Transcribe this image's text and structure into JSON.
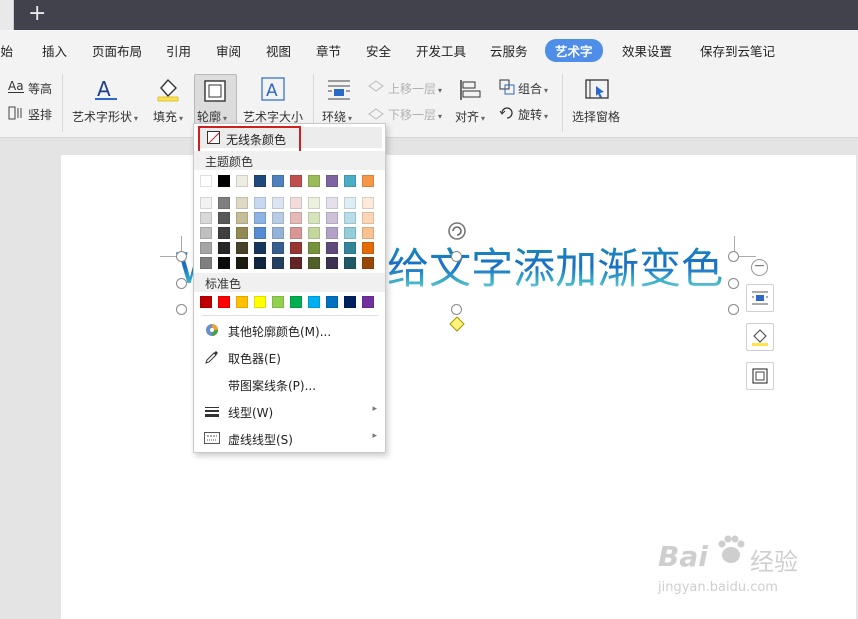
{
  "titlebar": {
    "new_tab": "+"
  },
  "menu": [
    {
      "label": "开始"
    },
    {
      "label": "插入"
    },
    {
      "label": "页面布局"
    },
    {
      "label": "引用"
    },
    {
      "label": "审阅"
    },
    {
      "label": "视图"
    },
    {
      "label": "章节"
    },
    {
      "label": "安全"
    },
    {
      "label": "开发工具"
    },
    {
      "label": "云服务"
    },
    {
      "label": "艺术字"
    },
    {
      "label": "效果设置"
    },
    {
      "label": "保存到云笔记"
    }
  ],
  "ribbon": {
    "equal_height": "等高",
    "vertical": "竖排",
    "shape": "艺术字形状",
    "fill": "填充",
    "outline": "轮廓",
    "size": "艺术字大小",
    "wrap": "环绕",
    "bring_forward": "上移一层",
    "send_backward": "下移一层",
    "align": "对齐",
    "group": "组合",
    "rotate": "旋转",
    "selection_pane": "选择窗格"
  },
  "document": {
    "art_text": "给文字添加渐变色",
    "art_text_prefix": "W"
  },
  "dropdown": {
    "no_line": "无线条颜色",
    "theme_colors_title": "主题颜色",
    "standard_colors_title": "标准色",
    "theme_top": [
      "#ffffff",
      "#000000",
      "#eeece1",
      "#1f497d",
      "#4f81bd",
      "#c0504d",
      "#9bbb59",
      "#8064a2",
      "#4bacc6",
      "#f79646"
    ],
    "theme_shades": [
      [
        "#f2f2f2",
        "#7f7f7f",
        "#ddd9c3",
        "#c6d9f0",
        "#dbe5f1",
        "#f2dcdb",
        "#ebf1dd",
        "#e5e0ec",
        "#dbeef3",
        "#fdeada"
      ],
      [
        "#d8d8d8",
        "#595959",
        "#c4bd97",
        "#8db3e2",
        "#b8cce4",
        "#e5b9b7",
        "#d7e3bc",
        "#ccc1d9",
        "#b7dde8",
        "#fbd5b5"
      ],
      [
        "#bfbfbf",
        "#3f3f3f",
        "#938953",
        "#548dd4",
        "#95b3d7",
        "#d99694",
        "#c3d69b",
        "#b2a2c7",
        "#92cddc",
        "#fac08f"
      ],
      [
        "#a5a5a5",
        "#262626",
        "#494429",
        "#17365d",
        "#366092",
        "#953734",
        "#76923c",
        "#5f497a",
        "#31859b",
        "#e36c09"
      ],
      [
        "#7f7f7f",
        "#0c0c0c",
        "#1d1b10",
        "#0f243e",
        "#244061",
        "#632423",
        "#4f6128",
        "#3f3151",
        "#205867",
        "#974806"
      ]
    ],
    "standard": [
      "#c00000",
      "#ff0000",
      "#ffc000",
      "#ffff00",
      "#92d050",
      "#00b050",
      "#00b0f0",
      "#0070c0",
      "#002060",
      "#7030a0"
    ],
    "more_colors": "其他轮廓颜色(M)...",
    "eyedropper": "取色器(E)",
    "pattern_line": "带图案线条(P)...",
    "line_style": "线型(W)",
    "dash_style": "虚线线型(S)"
  },
  "watermark": {
    "brand": "Bai",
    "brand2": "经验",
    "url": "jingyan.baidu.com"
  }
}
